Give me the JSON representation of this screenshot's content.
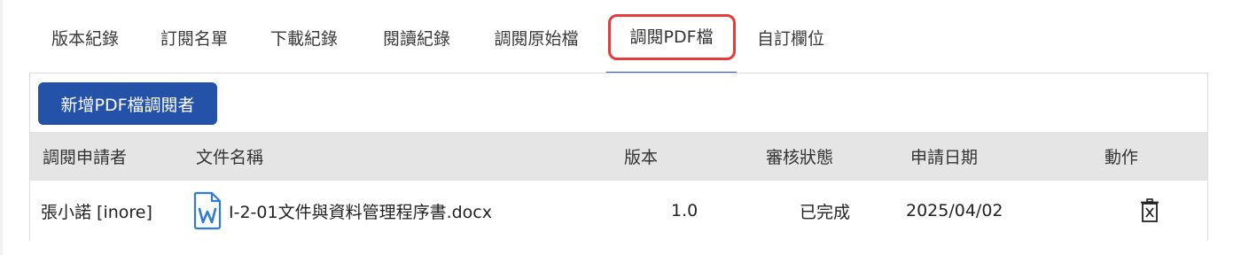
{
  "tabs": [
    {
      "label": "版本紀錄"
    },
    {
      "label": "訂閱名單"
    },
    {
      "label": "下載紀錄"
    },
    {
      "label": "閱讀紀錄"
    },
    {
      "label": "調閱原始檔"
    },
    {
      "label": "調閱PDF檔"
    },
    {
      "label": "自訂欄位"
    }
  ],
  "active_tab": "調閱PDF檔",
  "toolbar": {
    "add_label": "新增PDF檔調閱者"
  },
  "table": {
    "headers": [
      "調閱申請者",
      "文件名稱",
      "版本",
      "審核狀態",
      "申請日期",
      "動作"
    ],
    "rows": [
      {
        "applicant": "張小諾 [inore]",
        "file_icon": "word-document-icon",
        "file_name": "I-2-01文件與資料管理程序書.docx",
        "version": "1.0",
        "status": "已完成",
        "date": "2025/04/02",
        "action_icon": "delete-icon"
      }
    ]
  },
  "colors": {
    "accent": "#2352a8",
    "tab_underline": "#2f5fb3",
    "highlight_box": "#e53b3b",
    "header_bg": "#e5e5e5",
    "word_icon": "#2f7bd6"
  }
}
